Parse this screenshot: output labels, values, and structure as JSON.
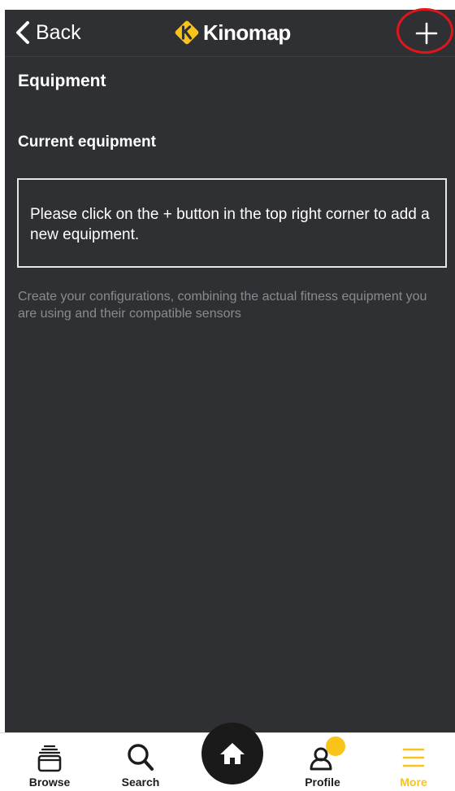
{
  "nav": {
    "back_label": "Back",
    "brand_name": "Kinomap"
  },
  "content": {
    "title": "Equipment",
    "subtitle": "Current equipment",
    "empty_message": "Please click on the + button in the top right corner to add a new equipment.",
    "hint": "Create your configurations, combining the actual fitness equipment you are using and their compatible sensors"
  },
  "tabs": [
    {
      "label": "Browse",
      "icon": "browse-icon"
    },
    {
      "label": "Search",
      "icon": "search-icon"
    },
    {
      "label": "Profile",
      "icon": "profile-icon"
    },
    {
      "label": "More",
      "icon": "menu-icon",
      "active": true
    }
  ],
  "colors": {
    "background": "#2f3034",
    "accent": "#f8c41b",
    "highlight": "#e0161b",
    "hint_text": "#8a8b8f"
  }
}
